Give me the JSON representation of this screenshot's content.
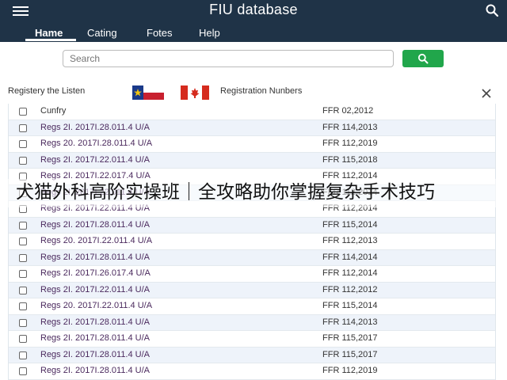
{
  "app": {
    "title": "FIU database"
  },
  "icons": {
    "menu": "hamburger-menu-icon",
    "search": "search-icon",
    "close": "close-icon"
  },
  "colors": {
    "appbar": "#1f3347",
    "search_button": "#21a64b",
    "row_alt": "#eef3fa",
    "link_text": "#4b2a5e"
  },
  "tabs": [
    {
      "label": "Hame",
      "active": true
    },
    {
      "label": "Cating",
      "active": false
    },
    {
      "label": "Fotes",
      "active": false
    },
    {
      "label": "Help",
      "active": false
    }
  ],
  "search": {
    "placeholder": "Search",
    "value": "Search"
  },
  "list": {
    "left_label": "Registery the Listen",
    "right_label": "Registration Nunbers",
    "flags": [
      "texas-flag",
      "canada-flag"
    ]
  },
  "table": {
    "header": {
      "col1": "Cunfry",
      "col2": "FFR 02,2012"
    },
    "rows": [
      {
        "col1": "Regs 2Ι. 2017Ι.28.011.4 U/A",
        "col2": "FFR 114,2013"
      },
      {
        "col1": "Regs 20. 2017Ι.28.011.4 U/A",
        "col2": "FFR 112,2019"
      },
      {
        "col1": "Regs 2Ι. 2017Ι.22.011.4 U/A",
        "col2": "FFR 115,2018"
      },
      {
        "col1": "Regs 2Ι. 2017Ι.22.017.4 U/A",
        "col2": "FFR 112,2014"
      },
      {
        "col1": "Regs 2Ι. 2017Ι.22.011.4 U/A",
        "col2": "FFR 112,2014"
      },
      {
        "col1": "Regs 2Ι. 2017Ι.22.011.4 U/A",
        "col2": "FFR 112,2014"
      },
      {
        "col1": "Regs 2Ι. 2017Ι.28.011.4 U/A",
        "col2": "FFR 115,2014"
      },
      {
        "col1": "Regs 20. 2017Ι.22.011.4 U/A",
        "col2": "FFR 112,2013"
      },
      {
        "col1": "Regs 2Ι. 2017Ι.28.011.4 U/A",
        "col2": "FFR 114,2014"
      },
      {
        "col1": "Regs 2Ι. 2017Ι.26.017.4 U/A",
        "col2": "FFR 112,2014"
      },
      {
        "col1": "Regs 2Ι. 2017Ι.22.011.4 U/A",
        "col2": "FFR 112,2012"
      },
      {
        "col1": "Regs 20. 2017Ι.22.011.4 U/A",
        "col2": "FFR 115,2014"
      },
      {
        "col1": "Regs 2Ι. 2017Ι.28.011.4 U/A",
        "col2": "FFR 114,2013"
      },
      {
        "col1": "Regs 2Ι. 2017Ι.28.011.4 U/A",
        "col2": "FFR 115,2017"
      },
      {
        "col1": "Regs 2Ι. 2017Ι.28.011.4 U/A",
        "col2": "FFR 115,2017"
      },
      {
        "col1": "Regs 2Ι. 2017Ι.28.011.4 U/A",
        "col2": "FFR 112,2019"
      }
    ]
  },
  "overlay": {
    "text": "犬猫外科高阶实操班｜全攻略助你掌握复杂手术技巧"
  }
}
